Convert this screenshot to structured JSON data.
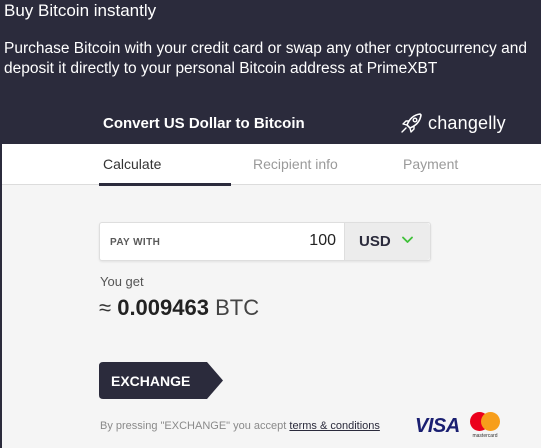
{
  "page": {
    "title": "Buy Bitcoin instantly",
    "description": "Purchase Bitcoin with your credit card or swap any other cryptocurrency and deposit it directly to your personal Bitcoin address at PrimeXBT"
  },
  "widget": {
    "title": "Convert US Dollar to Bitcoin",
    "brand": "changelly",
    "brand_icon": "rocket-icon"
  },
  "tabs": [
    {
      "label": "Calculate",
      "active": true
    },
    {
      "label": "Recipient info",
      "active": false
    },
    {
      "label": "Payment",
      "active": false
    }
  ],
  "form": {
    "pay_with_label": "PAY WITH",
    "amount": "100",
    "currency": "USD",
    "currency_chevron_icon": "chevron-down-icon",
    "you_get_label": "You get",
    "approx_symbol": "≈",
    "result_amount": "0.009463",
    "result_unit": "BTC"
  },
  "action": {
    "exchange_label": "EXCHANGE"
  },
  "footer": {
    "terms_prefix": "By pressing \"EXCHANGE\" you accept ",
    "terms_link": "terms & conditions",
    "visa": "VISA",
    "mastercard": "mastercard"
  },
  "colors": {
    "background": "#2b2b3c",
    "panel": "#f5f5f5",
    "accent_green": "#3fc13a",
    "button": "#2b2b3c"
  }
}
